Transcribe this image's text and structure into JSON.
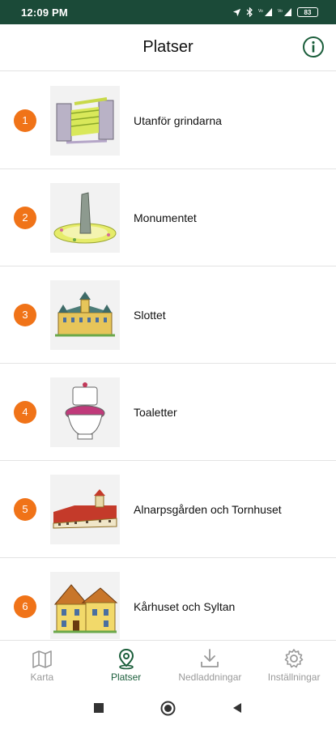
{
  "status_bar": {
    "time": "12:09 PM",
    "battery": "83"
  },
  "header": {
    "title": "Platser"
  },
  "places": [
    {
      "number": "1",
      "name": "Utanför grindarna",
      "thumb_icon": "gate-illustration"
    },
    {
      "number": "2",
      "name": "Monumentet",
      "thumb_icon": "monument-illustration"
    },
    {
      "number": "3",
      "name": "Slottet",
      "thumb_icon": "castle-illustration"
    },
    {
      "number": "4",
      "name": "Toaletter",
      "thumb_icon": "toilet-illustration"
    },
    {
      "number": "5",
      "name": "Alnarpsgården och Tornhuset",
      "thumb_icon": "farmhouse-illustration"
    },
    {
      "number": "6",
      "name": "Kårhuset och Syltan",
      "thumb_icon": "house-illustration"
    }
  ],
  "bottom_nav": [
    {
      "label": "Karta",
      "icon": "map-icon",
      "active": false
    },
    {
      "label": "Platser",
      "icon": "location-pin-icon",
      "active": true
    },
    {
      "label": "Nedladdningar",
      "icon": "download-icon",
      "active": false
    },
    {
      "label": "Inställningar",
      "icon": "gear-icon",
      "active": false
    }
  ],
  "colors": {
    "status_bar": "#1b4a38",
    "accent": "#1b5e3b",
    "badge": "#f07318",
    "inactive": "#9a9a9a"
  }
}
